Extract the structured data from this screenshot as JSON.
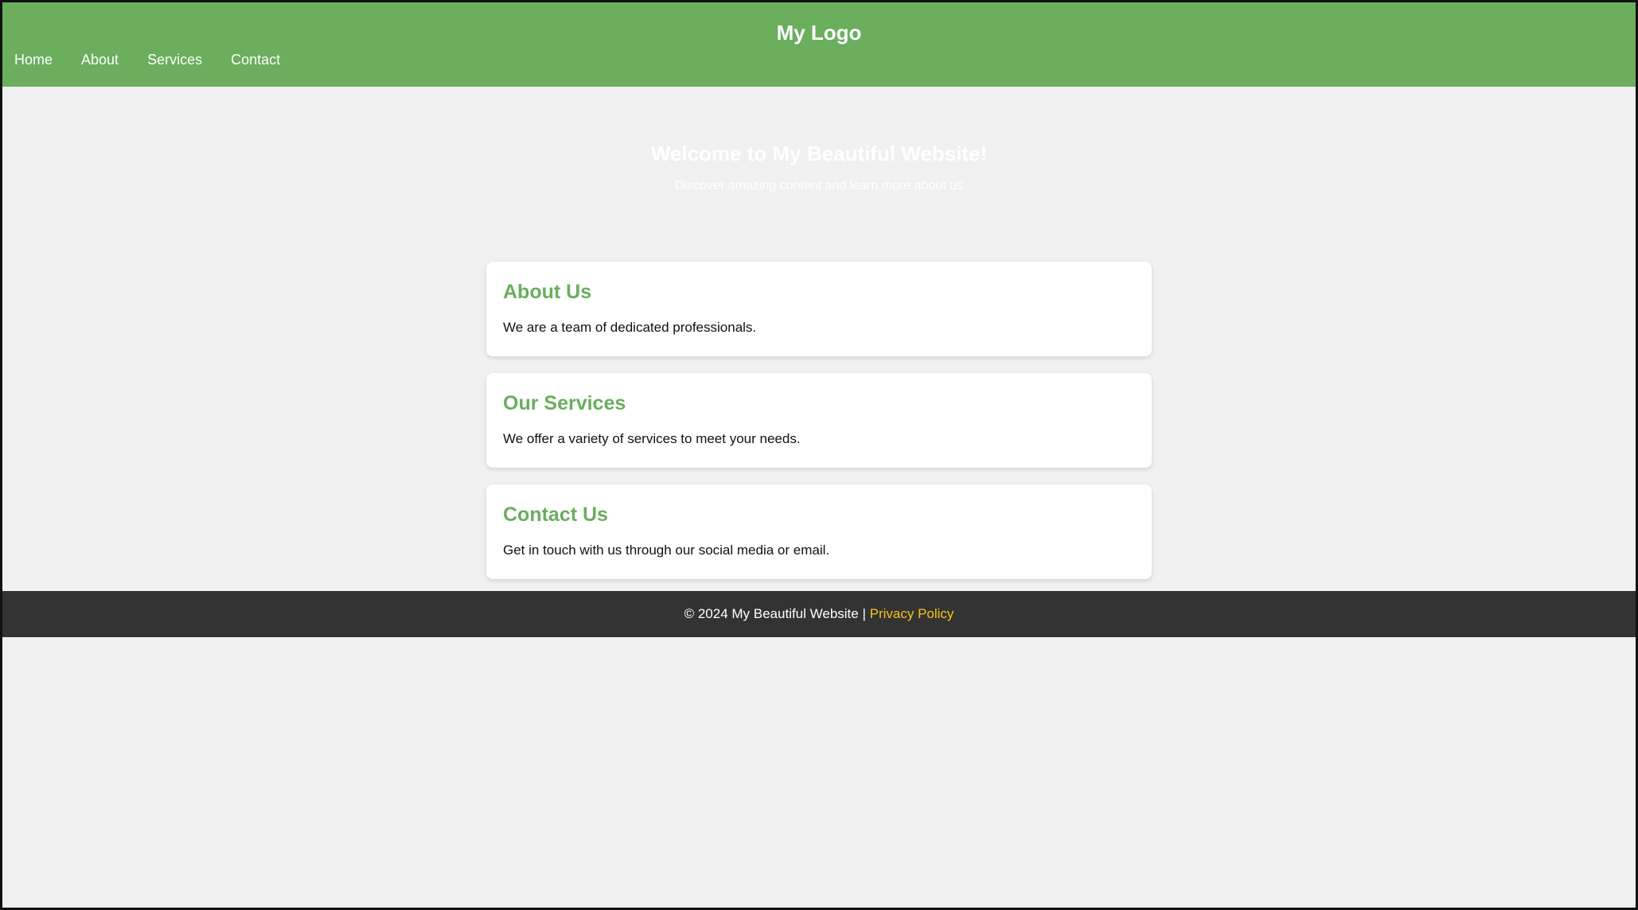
{
  "header": {
    "logo": "My Logo",
    "nav": [
      "Home",
      "About",
      "Services",
      "Contact"
    ]
  },
  "hero": {
    "title": "Welcome to My Beautiful Website!",
    "subtitle": "Discover amazing content and learn more about us"
  },
  "sections": [
    {
      "title": "About Us",
      "text": "We are a team of dedicated professionals."
    },
    {
      "title": "Our Services",
      "text": "We offer a variety of services to meet your needs."
    },
    {
      "title": "Contact Us",
      "text": "Get in touch with us through our social media or email."
    }
  ],
  "footer": {
    "copyright": "© 2024 My Beautiful Website | ",
    "link": "Privacy Policy"
  },
  "colors": {
    "header_bg": "#6aae5e",
    "footer_bg": "#333333",
    "link": "#f5c518"
  }
}
